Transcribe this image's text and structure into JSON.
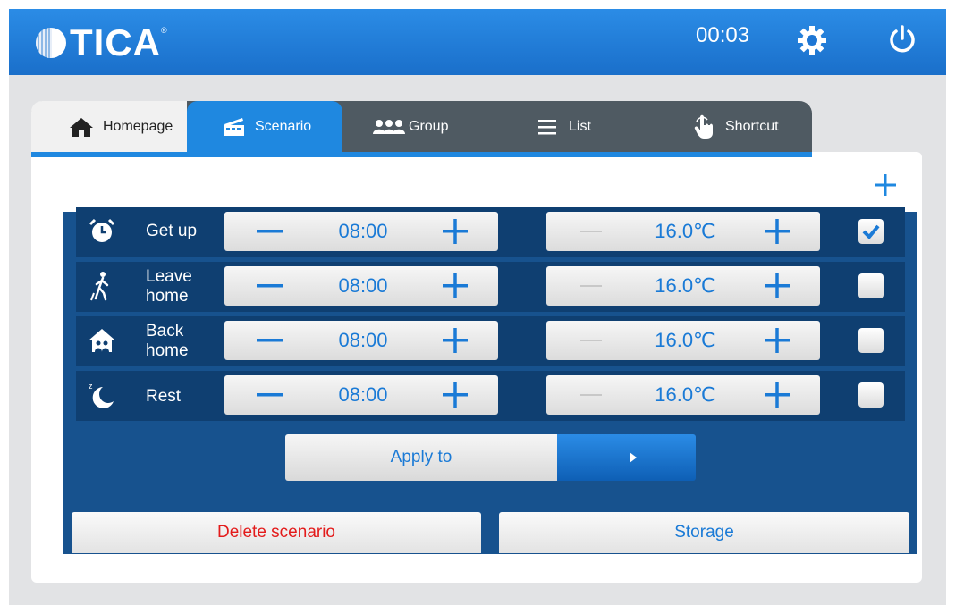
{
  "brand": {
    "name": "TICA",
    "registered": "®"
  },
  "header": {
    "time": "00:03",
    "settings_icon": "gear-icon",
    "power_icon": "power-icon"
  },
  "tabs": [
    {
      "label": "Homepage",
      "icon": "home-icon"
    },
    {
      "label": "Scenario",
      "icon": "clapperboard-icon"
    },
    {
      "label": "Group",
      "icon": "people-group-icon"
    },
    {
      "label": "List",
      "icon": "list-icon"
    },
    {
      "label": "Shortcut",
      "icon": "hand-pointer-icon"
    }
  ],
  "active_tab": "Scenario",
  "scenarios": [
    {
      "label": "Get up",
      "time": "08:00",
      "temperature": "16.0℃",
      "checked": true,
      "icon": "alarm-clock-icon"
    },
    {
      "label": "Leave home",
      "time": "08:00",
      "temperature": "16.0℃",
      "checked": false,
      "icon": "walking-person-icon"
    },
    {
      "label": "Back home",
      "time": "08:00",
      "temperature": "16.0℃",
      "checked": false,
      "icon": "house-icon"
    },
    {
      "label": "Rest",
      "time": "08:00",
      "temperature": "16.0℃",
      "checked": false,
      "icon": "moon-sleep-icon"
    }
  ],
  "actions": {
    "apply": "Apply to",
    "delete": "Delete scenario",
    "storage": "Storage"
  },
  "colors": {
    "accent": "#1f88e0",
    "panel_dark": "#0f3f71",
    "text_blue": "#1a7ad6",
    "danger": "#e31b1b"
  }
}
